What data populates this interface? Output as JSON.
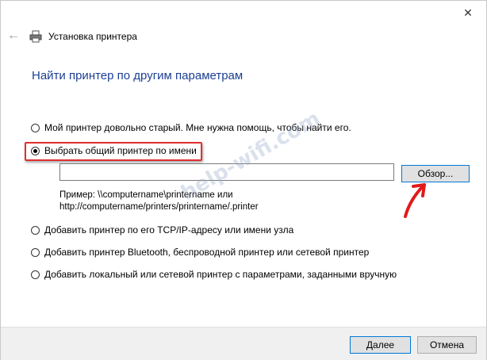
{
  "window": {
    "close_symbol": "✕",
    "back_symbol": "←",
    "icons": {
      "close": "close-icon",
      "back": "back-arrow-icon",
      "printer": "printer-icon"
    }
  },
  "header": {
    "title": "Установка принтера",
    "heading": "Найти принтер по другим параметрам"
  },
  "options": [
    {
      "label": "Мой принтер довольно старый. Мне нужна помощь, чтобы найти его.",
      "checked": false
    },
    {
      "label": "Выбрать общий принтер по имени",
      "checked": true
    },
    {
      "label": "Добавить принтер по его TCP/IP-адресу или имени узла",
      "checked": false
    },
    {
      "label": "Добавить принтер Bluetooth, беспроводной принтер или сетевой принтер",
      "checked": false
    },
    {
      "label": "Добавить локальный или сетевой принтер с параметрами, заданными вручную",
      "checked": false
    }
  ],
  "shared_printer": {
    "value": "",
    "browse_label": "Обзор...",
    "example_line1": "Пример: \\\\computername\\printername или",
    "example_line2": "http://computername/printers/printername/.printer"
  },
  "watermark": "help-wifi.com",
  "footer": {
    "next_label": "Далее",
    "cancel_label": "Отмена"
  },
  "colors": {
    "heading": "#1c3f94",
    "highlight": "#e02f2f",
    "focus_border": "#0078d7",
    "footer_bg": "#f0f0f0"
  }
}
